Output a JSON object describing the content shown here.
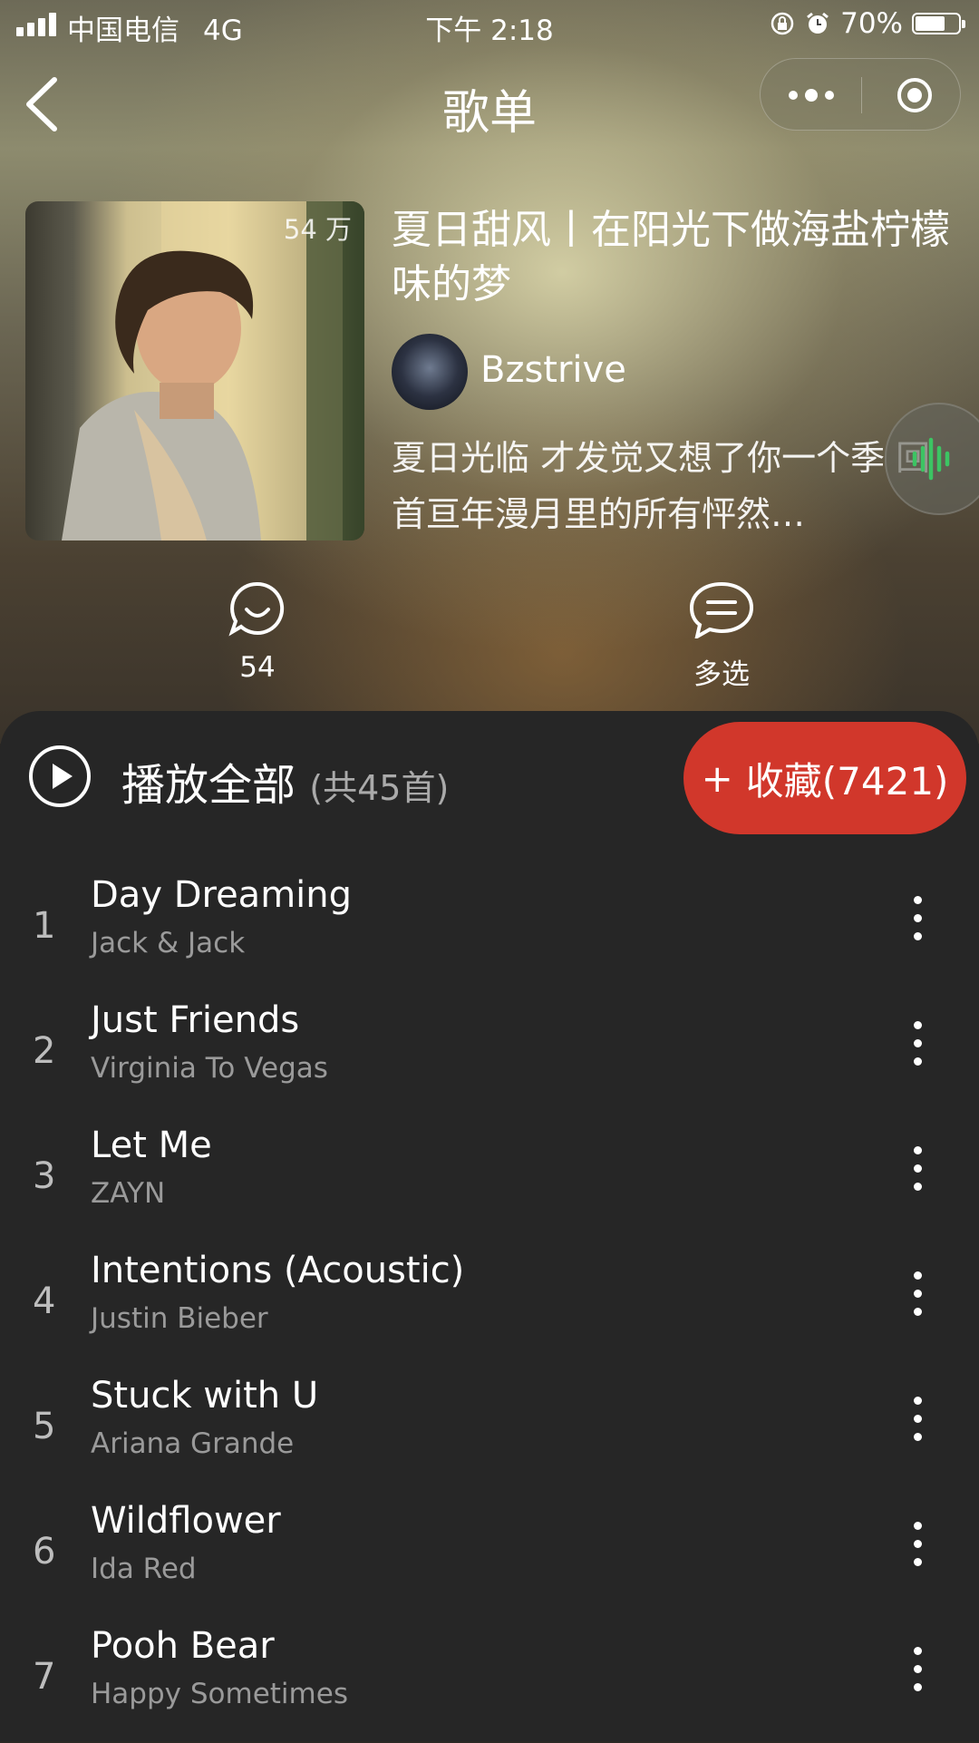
{
  "status_bar": {
    "carrier": "中国电信",
    "network": "4G",
    "time": "下午 2:18",
    "battery_percent": "70%",
    "battery_level": 0.7
  },
  "nav": {
    "title": "歌单",
    "back_icon": "chevron-left-icon",
    "menu_icon": "more-dots-icon",
    "close_icon": "target-circle-icon"
  },
  "playlist": {
    "play_count": "54 万",
    "title": "夏日甜风丨在阳光下做海盐柠檬味的梦",
    "creator": "Bzstrive",
    "description": "夏日光临 才发觉又想了你一个季 回首亘年漫月里的所有怦然…"
  },
  "actions": {
    "comment_count": "54",
    "multi_select_label": "多选"
  },
  "list_header": {
    "play_all_label": "播放全部",
    "song_count_label": "(共45首)",
    "collect_label": "收藏(7421)",
    "collect_plus": "+"
  },
  "colors": {
    "accent": "#d1372b",
    "panel": "#262626",
    "voice_icon": "#3cc463"
  },
  "songs": [
    {
      "index": "1",
      "title": "Day Dreaming",
      "artist": "Jack & Jack"
    },
    {
      "index": "2",
      "title": "Just Friends",
      "artist": "Virginia To Vegas"
    },
    {
      "index": "3",
      "title": "Let Me",
      "artist": "ZAYN"
    },
    {
      "index": "4",
      "title": "Intentions (Acoustic)",
      "artist": "Justin Bieber"
    },
    {
      "index": "5",
      "title": "Stuck with U",
      "artist": "Ariana Grande"
    },
    {
      "index": "6",
      "title": "Wildflower",
      "artist": "Ida Red"
    },
    {
      "index": "7",
      "title": "Pooh Bear",
      "artist": "Happy Sometimes"
    }
  ]
}
